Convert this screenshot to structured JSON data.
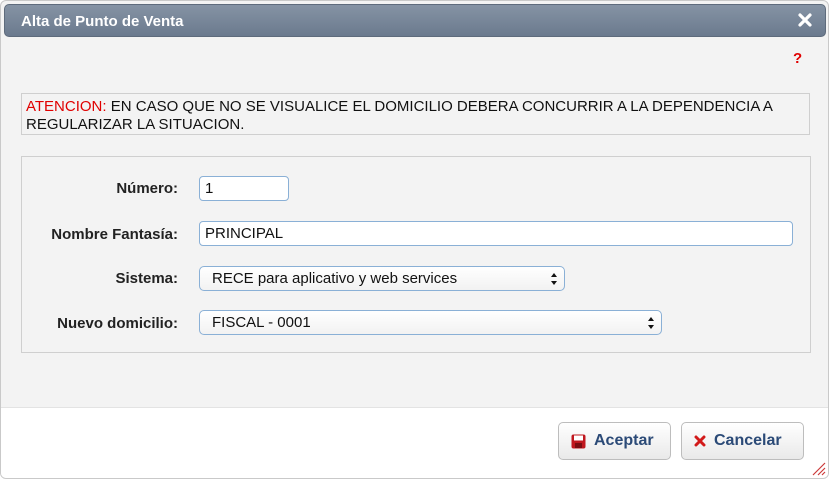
{
  "dialog": {
    "title": "Alta de Punto de Venta",
    "help_label": "?"
  },
  "warning": {
    "label": "ATENCION:",
    "text": " EN CASO QUE NO SE VISUALICE EL DOMICILIO DEBERA CONCURRIR A LA DEPENDENCIA A REGULARIZAR LA SITUACION."
  },
  "form": {
    "numero": {
      "label": "Número:",
      "value": "1"
    },
    "nombre_fantasia": {
      "label": "Nombre Fantasía:",
      "value": "PRINCIPAL"
    },
    "sistema": {
      "label": "Sistema:",
      "selected": "RECE para aplicativo y web services"
    },
    "nuevo_domicilio": {
      "label": "Nuevo domicilio:",
      "selected": "FISCAL - 0001"
    }
  },
  "buttons": {
    "accept_label": "Aceptar",
    "cancel_label": "Cancelar"
  },
  "colors": {
    "titlebar": "#7a8799",
    "warning_label": "#e00000",
    "button_text": "#2b4a77",
    "accept_icon": "#c0181f",
    "cancel_icon": "#d21a1a"
  }
}
